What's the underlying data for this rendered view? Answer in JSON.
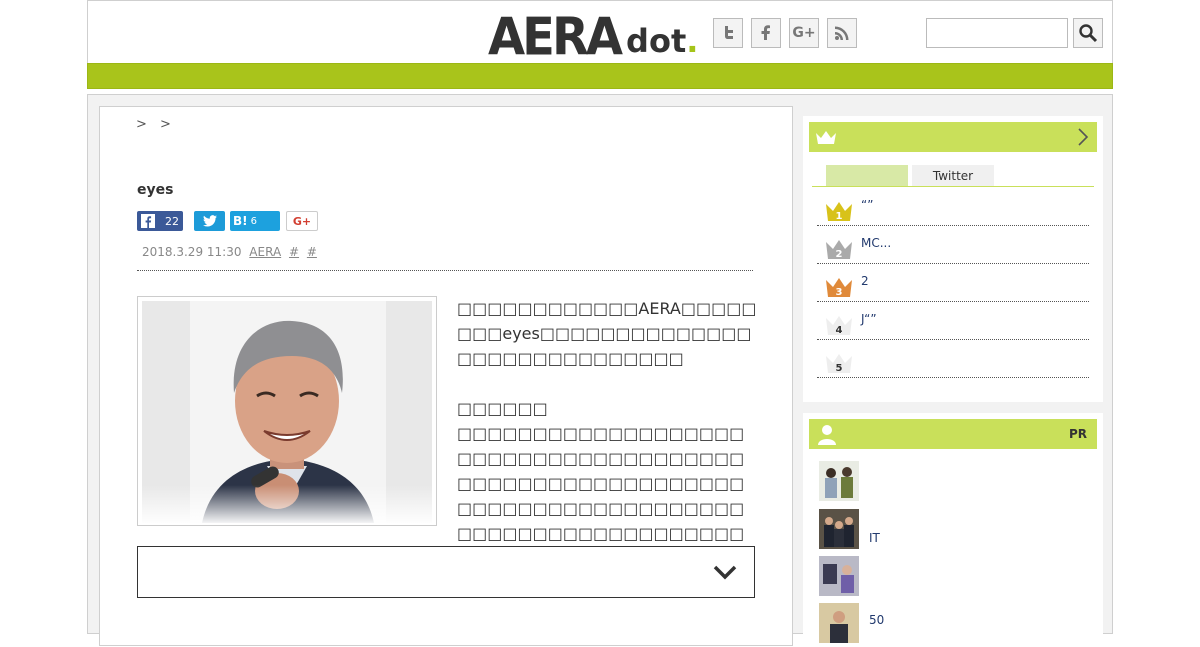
{
  "header": {
    "logo_main": "AERA",
    "logo_sub": "dot",
    "logo_period": ".",
    "social": [
      {
        "name": "twitter-icon",
        "glyph": "t"
      },
      {
        "name": "facebook-icon",
        "glyph": "f"
      },
      {
        "name": "google-plus-icon",
        "glyph": "G+"
      },
      {
        "name": "rss-icon",
        "glyph": "))"
      }
    ],
    "search_placeholder": ""
  },
  "article": {
    "breadcrumb_sep": ">",
    "title": "eyes",
    "share": {
      "facebook_count": "22",
      "hatena_label": "B!",
      "hatena_count": "6",
      "gplus_label": "G+"
    },
    "meta": {
      "date": "2018.3.29 11:30",
      "source": "AERA",
      "tag1": "#",
      "tag2": "#"
    },
    "body": "□□□□□□□□□□□□AERA□□□□□□□□eyes□□□□□□□□□□□□□□□□□□□□□□□□□□□□□\n\n□□□□□□\n□□□□□□□□□□□□□□□□□□□□□□□□□□□□□□□□□□□□□□□□□□□□□□□□□□□□□□□□□□□□□□□□□□□□□□□□□□□□□□□□□□□□□□□□□□□□□□□□□□"
  },
  "sidebar": {
    "ranking": {
      "tabs": [
        "",
        "Twitter"
      ],
      "items": [
        {
          "rank": "1",
          "text": "“”"
        },
        {
          "rank": "2",
          "text": "MC..."
        },
        {
          "rank": "3",
          "text": "2"
        },
        {
          "rank": "4",
          "text": "J“”"
        },
        {
          "rank": "5",
          "text": ""
        }
      ]
    },
    "pr": {
      "label": "PR",
      "items": [
        {
          "text": ""
        },
        {
          "text": "IT"
        },
        {
          "text": ""
        },
        {
          "text": "50"
        }
      ]
    }
  },
  "colors": {
    "brand_green": "#a9c41b",
    "light_green": "#c9e05a",
    "gold": "#d8c21a",
    "silver": "#aaaaaa",
    "bronze": "#e08a3a"
  }
}
